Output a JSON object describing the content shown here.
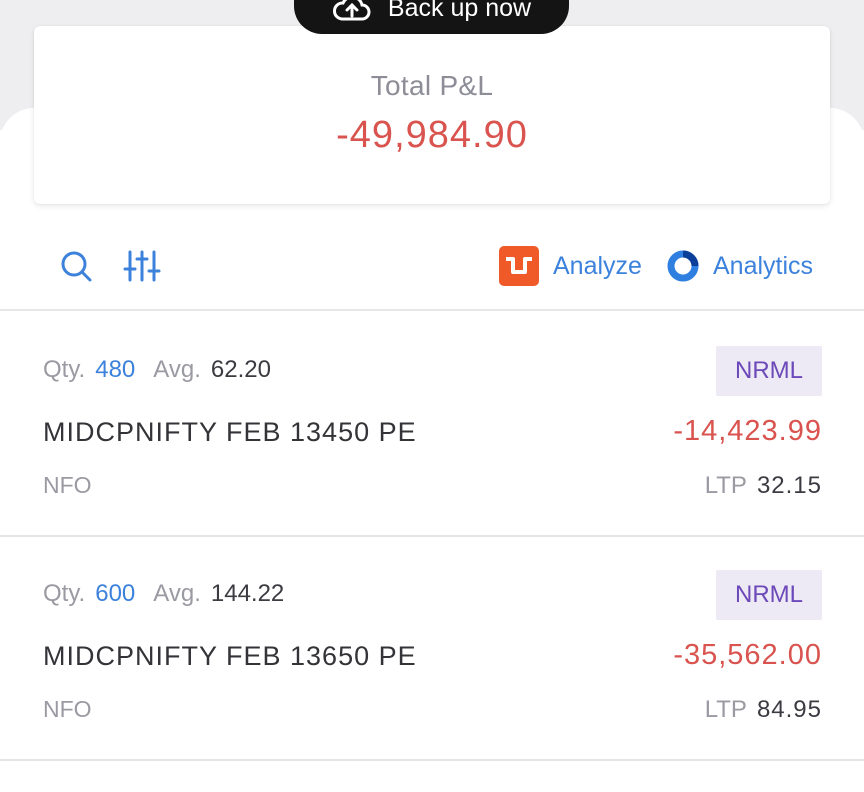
{
  "backup_banner": {
    "label": "Back up now",
    "icon": "cloud-upload-icon"
  },
  "summary": {
    "label": "Total P&L",
    "value": "-49,984.90"
  },
  "toolbar": {
    "search_icon": "search-icon",
    "filter_icon": "sliders-icon",
    "analyze_label": "Analyze",
    "analytics_label": "Analytics"
  },
  "colors": {
    "accent": "#3c82dc",
    "loss": "#d9534f",
    "badge_bg": "#ede9f5",
    "badge_text": "#6c49b8",
    "analyze_brand": "#f05a28"
  },
  "positions": [
    {
      "qty_label": "Qty.",
      "qty": "480",
      "avg_label": "Avg.",
      "avg": "62.20",
      "product": "NRML",
      "instrument": "MIDCPNIFTY FEB 13450 PE",
      "pnl": "-14,423.99",
      "exchange": "NFO",
      "ltp_label": "LTP",
      "ltp": "32.15"
    },
    {
      "qty_label": "Qty.",
      "qty": "600",
      "avg_label": "Avg.",
      "avg": "144.22",
      "product": "NRML",
      "instrument": "MIDCPNIFTY FEB 13650 PE",
      "pnl": "-35,562.00",
      "exchange": "NFO",
      "ltp_label": "LTP",
      "ltp": "84.95"
    }
  ]
}
